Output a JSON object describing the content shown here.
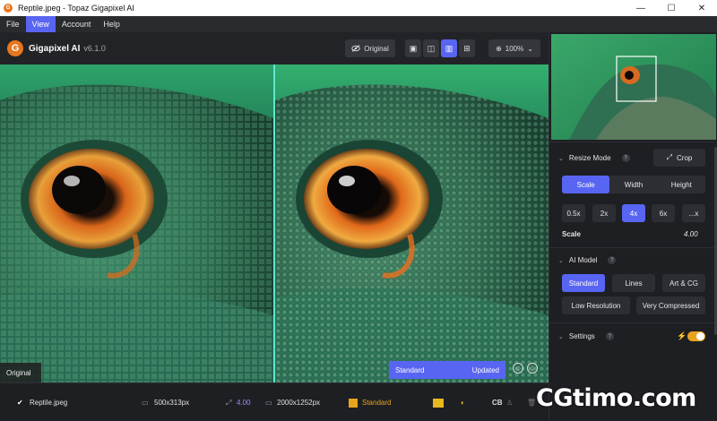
{
  "window": {
    "title": "Reptile.jpeg - Topaz Gigapixel AI",
    "controls": [
      "—",
      "☐",
      "✕"
    ]
  },
  "menu": {
    "items": [
      "File",
      "View",
      "Account",
      "Help"
    ],
    "active": "View"
  },
  "header": {
    "app_name": "Gigapixel AI",
    "version": "v6.1.0",
    "original_button": "Original",
    "zoom": "100%"
  },
  "preview": {
    "original_label": "Original",
    "model_status": "Standard",
    "update_status": "Updated"
  },
  "footer": {
    "filename": "Reptile.jpeg",
    "input_size": "500x313px",
    "scale": "4.00",
    "output_size": "2000x1252px",
    "model": "Standard",
    "cb": "CB"
  },
  "side": {
    "resize_mode": {
      "label": "Resize Mode",
      "help": "?",
      "crop_button": "Crop",
      "modes": [
        "Scale",
        "Width",
        "Height"
      ],
      "active_mode": "Scale",
      "scale_options": [
        "0.5x",
        "2x",
        "4x",
        "6x",
        "...x"
      ],
      "active_scale": "4x",
      "scale_label": "Scale",
      "scale_value": "4.00"
    },
    "ai_model": {
      "label": "AI Model",
      "help": "?",
      "models": [
        "Standard",
        "Lines",
        "Art & CG",
        "Low Resolution",
        "Very Compressed"
      ],
      "active_model": "Standard"
    },
    "settings": {
      "label": "Settings",
      "help": "?",
      "enabled": true
    }
  },
  "watermark": "CGtimo.com",
  "colors": {
    "accent": "#5865f2",
    "highlight": "#e8a31e",
    "divider": "#60e7d0",
    "background": "#1b1c1f"
  }
}
